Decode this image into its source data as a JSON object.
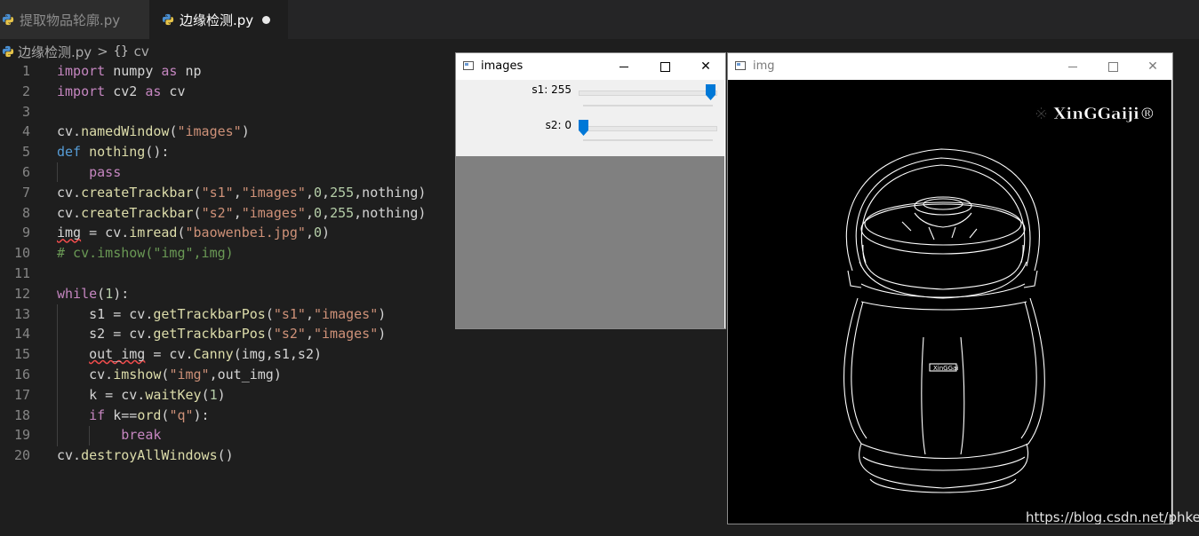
{
  "tabs": [
    {
      "label": "提取物品轮廓.py",
      "active": false
    },
    {
      "label": "边缘检测.py",
      "active": true,
      "unsaved": true
    }
  ],
  "breadcrumb": {
    "file": "边缘检测.py",
    "separator": ">",
    "symbol_icon": "{}",
    "symbol": "cv"
  },
  "code": {
    "line_numbers": [
      "1",
      "2",
      "3",
      "4",
      "5",
      "6",
      "7",
      "8",
      "9",
      "10",
      "11",
      "12",
      "13",
      "14",
      "15",
      "16",
      "17",
      "18",
      "19",
      "20"
    ],
    "lines": [
      "import numpy as np",
      "import cv2 as cv",
      "",
      "cv.namedWindow(\"images\")",
      "def nothing():",
      "    pass",
      "cv.createTrackbar(\"s1\",\"images\",0,255,nothing)",
      "cv.createTrackbar(\"s2\",\"images\",0,255,nothing)",
      "img = cv.imread(\"baowenbei.jpg\",0)",
      "# cv.imshow(\"img\",img)",
      "",
      "while(1):",
      "    s1 = cv.getTrackbarPos(\"s1\",\"images\")",
      "    s2 = cv.getTrackbarPos(\"s2\",\"images\")",
      "    out_img = cv.Canny(img,s1,s2)",
      "    cv.imshow(\"img\",out_img)",
      "    k = cv.waitKey(1)",
      "    if k==ord(\"q\"):",
      "        break",
      "cv.destroyAllWindows()"
    ]
  },
  "images_window": {
    "title": "images",
    "controls": {
      "minimize": "minimize",
      "maximize": "maximize",
      "close": "✕"
    },
    "trackbars": [
      {
        "label": "s1: 255",
        "value": 255,
        "max": 255
      },
      {
        "label": "s2: 0",
        "value": 0,
        "max": 255
      }
    ]
  },
  "img_window": {
    "title": "img",
    "controls": {
      "minimize": "minimize",
      "maximize": "maximize",
      "close": "✕"
    },
    "logo_text": "※ XinGGaiji®",
    "cup_label": "XinGGai"
  },
  "watermark": "https://blog.csdn.net/phker",
  "colors": {
    "editor_bg": "#1e1e1e",
    "keyword": "#c586c0",
    "string": "#ce9178",
    "number": "#b5cea8",
    "comment": "#6a9955",
    "thumb": "#0078d7"
  }
}
